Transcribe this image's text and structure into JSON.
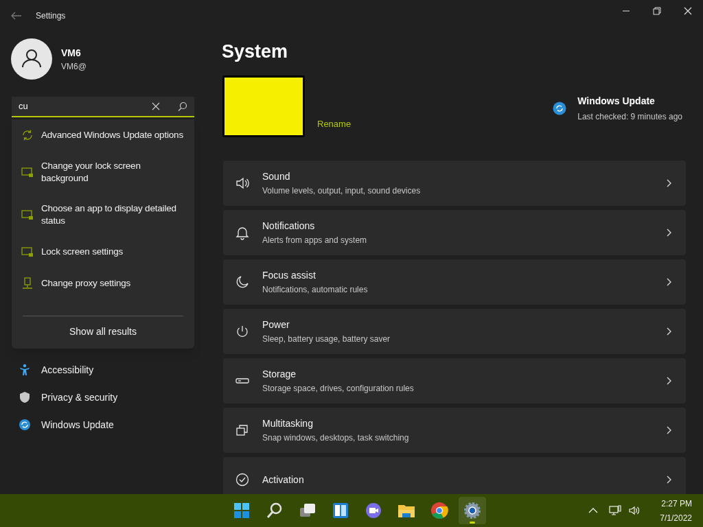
{
  "window": {
    "title": "Settings"
  },
  "profile": {
    "name": "VM6",
    "email": "VM6@"
  },
  "search": {
    "value": "cu"
  },
  "search_results": [
    {
      "label": "Advanced Windows Update options",
      "kind": "update"
    },
    {
      "label": "Change your lock screen background",
      "kind": "lockscreen"
    },
    {
      "label": "Choose an app to display detailed status",
      "kind": "lockscreen"
    },
    {
      "label": "Lock screen settings",
      "kind": "lockscreen"
    },
    {
      "label": "Change proxy settings",
      "kind": "proxy"
    }
  ],
  "show_all": "Show all results",
  "sidebar": {
    "items": [
      {
        "label": "Accessibility",
        "kind": "accessibility"
      },
      {
        "label": "Privacy & security",
        "kind": "privacy"
      },
      {
        "label": "Windows Update",
        "kind": "update"
      }
    ]
  },
  "page_title": "System",
  "device": {
    "action": "Rename"
  },
  "update_status": {
    "title": "Windows Update",
    "subtitle": "Last checked: 9 minutes ago"
  },
  "cards": [
    {
      "title": "Sound",
      "subtitle": "Volume levels, output, input, sound devices",
      "kind": "sound"
    },
    {
      "title": "Notifications",
      "subtitle": "Alerts from apps and system",
      "kind": "bell"
    },
    {
      "title": "Focus assist",
      "subtitle": "Notifications, automatic rules",
      "kind": "moon"
    },
    {
      "title": "Power",
      "subtitle": "Sleep, battery usage, battery saver",
      "kind": "power"
    },
    {
      "title": "Storage",
      "subtitle": "Storage space, drives, configuration rules",
      "kind": "storage"
    },
    {
      "title": "Multitasking",
      "subtitle": "Snap windows, desktops, task switching",
      "kind": "multitask"
    },
    {
      "title": "Activation",
      "kind": "check"
    }
  ],
  "taskbar": {
    "apps": [
      {
        "kind": "start",
        "selected": false
      },
      {
        "kind": "search",
        "selected": false
      },
      {
        "kind": "taskview",
        "selected": false
      },
      {
        "kind": "widgets",
        "selected": false
      },
      {
        "kind": "chat",
        "selected": false
      },
      {
        "kind": "explorer",
        "selected": false
      },
      {
        "kind": "browser",
        "selected": false
      },
      {
        "kind": "settings",
        "selected": true
      }
    ],
    "time": "2:27 PM",
    "date": "7/1/2022"
  }
}
